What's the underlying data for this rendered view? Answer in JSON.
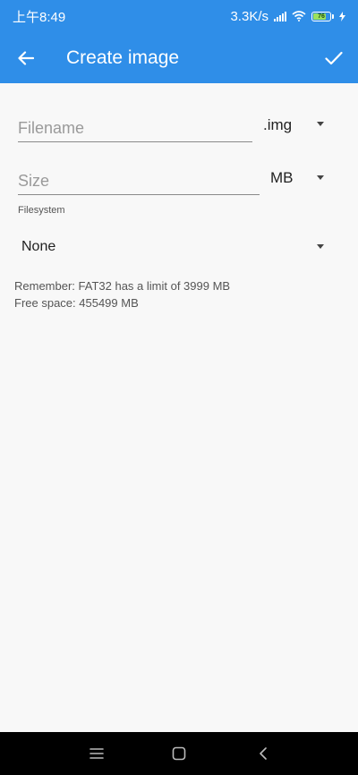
{
  "status": {
    "time": "上午8:49",
    "speed": "3.3K/s",
    "battery": "76"
  },
  "appbar": {
    "title": "Create image",
    "back_icon": "arrow-back-icon",
    "confirm_icon": "checkmark-icon"
  },
  "form": {
    "filename_placeholder": "Filename",
    "extension": ".img",
    "size_placeholder": "Size",
    "unit": "MB",
    "filesystem_label": "Filesystem",
    "filesystem_value": "None"
  },
  "info": {
    "line1": "Remember: FAT32 has a limit of 3999 MB",
    "line2": "Free space: 455499 MB"
  },
  "colors": {
    "accent": "#2f8ee8",
    "background": "#f8f8f8",
    "nav": "#000000"
  }
}
